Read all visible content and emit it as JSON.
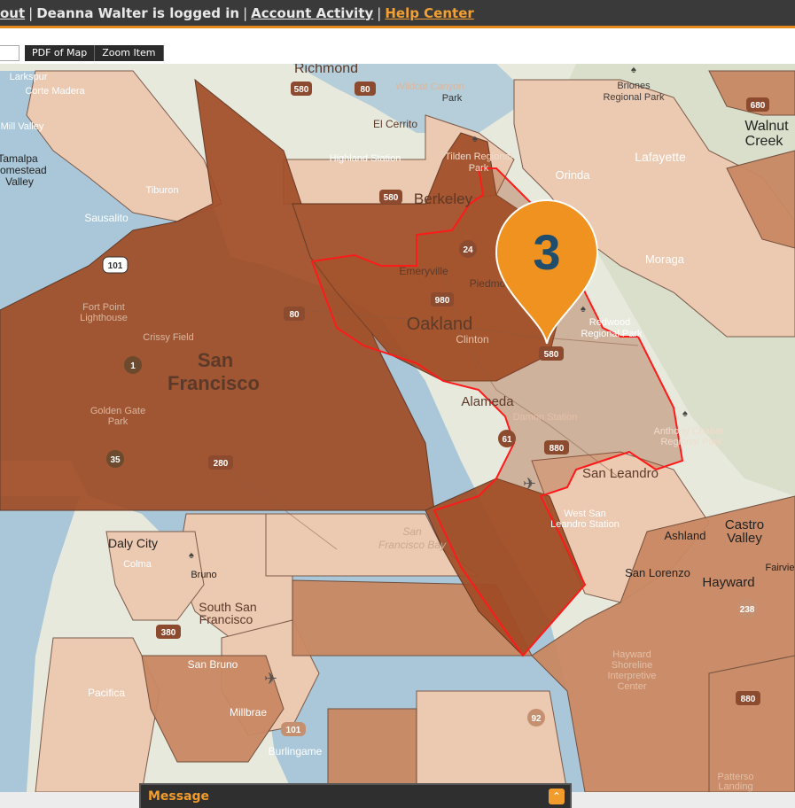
{
  "header": {
    "logout_text": "out",
    "user_text": "Deanna Walter is logged in",
    "account_activity": "Account Activity",
    "help_center": "Help Center"
  },
  "toolbar": {
    "pdf_label": "PDF of Map",
    "zoom_label": "Zoom Item"
  },
  "map": {
    "marker_number": "3",
    "cities": {
      "richmond": "Richmond",
      "berkeley": "Berkeley",
      "oakland": "Oakland",
      "san_francisco_1": "San",
      "san_francisco_2": "Francisco",
      "alameda": "Alameda",
      "san_leandro": "San Leandro",
      "castro_valley_1": "Castro",
      "castro_valley_2": "Valley",
      "walnut_creek_1": "Walnut",
      "walnut_creek_2": "Creek",
      "lafayette": "Lafayette",
      "moraga": "Moraga",
      "orinda": "Orinda",
      "sausalito": "Sausalito",
      "tamalpais_1": "Tamalpa",
      "tamalpais_2": "Homestead",
      "tamalpais_3": "Valley",
      "daly_city": "Daly City",
      "south_sf_1": "South San",
      "south_sf_2": "Francisco",
      "san_bruno": "San Bruno",
      "pacifica": "Pacifica",
      "millbrae": "Millbrae",
      "burlingame": "Burlingame",
      "hayward": "Hayward",
      "ashland": "Ashland",
      "san_lorenzo": "San Lorenzo",
      "emeryville": "Emeryville",
      "piedmont": "Piedmont",
      "clinton": "Clinton",
      "el_cerrito": "El Cerrito",
      "corte_madera": "Corte Madera",
      "larkspur": "Larkspur",
      "mill_valley": "Mill Valley",
      "tiburon": "Tiburon",
      "colma": "Colma",
      "brisbane": "Bruno",
      "fairview": "Fairvie",
      "san_francisco_bay_1": "San",
      "san_francisco_bay_2": "Francisco Bay",
      "fruitvale": "Damon Station"
    },
    "places": {
      "briones_1": "Briones",
      "briones_2": "Regional Park",
      "redwood_1": "Redwood",
      "redwood_2": "Regional Park",
      "chabot_1": "Anthony Chabot",
      "chabot_2": "Regional Park",
      "tilden_1": "Tilden Regional",
      "tilden_2": "Park",
      "fort_point_1": "Fort Point",
      "fort_point_2": "Lighthouse",
      "crissy": "Crissy Field",
      "golden_gate_1": "Golden Gate",
      "golden_gate_2": "Park",
      "highland": "Highland Station",
      "hayward_shore_1": "Hayward",
      "hayward_shore_2": "Shoreline",
      "hayward_shore_3": "Interpretive",
      "hayward_shore_4": "Center",
      "west_san_1": "West San",
      "west_san_2": "Leandro Station",
      "wildcat_1": "Wildcat Canyon",
      "wildcat_2": "Park",
      "patterson_1": "Patterso",
      "patterson_2": "Landing"
    },
    "shields": {
      "i580_a": "580",
      "i80_a": "80",
      "i580_b": "580",
      "i980": "980",
      "r24": "24",
      "i80_b": "80",
      "i580_c": "580",
      "i880_a": "880",
      "r61": "61",
      "us101_a": "101",
      "r1": "1",
      "r35": "35",
      "i280": "280",
      "i880_b": "880",
      "r92": "92",
      "us101_b": "101",
      "r238": "238",
      "i380": "380",
      "i680": "680"
    }
  },
  "message": {
    "title": "Message",
    "toggle": "⌃"
  },
  "colors": {
    "accent": "#e58a1a",
    "marker": "#f0921f",
    "marker_text": "#1f4d6b",
    "selected_border": "#ff1a1a",
    "region_dark": "#a14d26",
    "region_mid": "#c47e5a",
    "region_light": "#ecc9b1",
    "water": "#a9c7d8"
  }
}
